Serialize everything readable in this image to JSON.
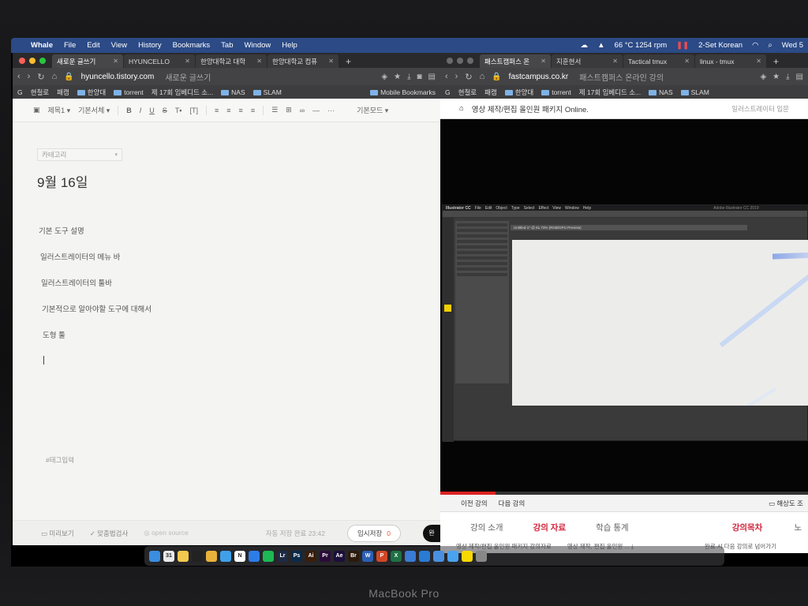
{
  "menubar": {
    "apple_glyph": "",
    "items": [
      "Whale",
      "File",
      "Edit",
      "View",
      "History",
      "Bookmarks",
      "Tab",
      "Window",
      "Help"
    ],
    "status": {
      "weather": "66 °C 1254 rpm",
      "input_method": "2-Set Korean",
      "clock": "Wed 5"
    }
  },
  "left_browser": {
    "tabs": [
      {
        "label": "새로운 글쓰기",
        "active": true
      },
      {
        "label": "HYUNCELLO",
        "active": false
      },
      {
        "label": "한양대학교 대학",
        "active": false
      },
      {
        "label": "한양대학교 컴퓨",
        "active": false
      }
    ],
    "url": "hyuncello.tistory.com",
    "url_subtitle": "새로운 글쓰기",
    "bookmarks": [
      "G",
      "현철로",
      "패캠",
      "한양대",
      "torrent",
      "제 17회 임베디드 소...",
      "NAS",
      "SLAM"
    ],
    "bookmarks_right": "Mobile Bookmarks"
  },
  "editor": {
    "toolbar": {
      "heading": "제목1",
      "font": "기본서체",
      "mode": "기본모드"
    },
    "category_placeholder": "카테고리",
    "title": "9월 16일",
    "lines": [
      "기본 도구 설명",
      "일러스트레이터의 메뉴 바",
      "일러스트레이터의 툴바",
      "기본적으로 알아야할 도구에 대해서",
      "도형 툴"
    ],
    "tag_placeholder": "#태그입력",
    "footer": {
      "preview": "미리보기",
      "spellcheck": "맞춤법검사",
      "open_source": "open source",
      "autosave": "자동 저장 완료 23:42",
      "draft_label": "임시저장",
      "draft_count": "0",
      "publish": "완"
    }
  },
  "right_browser": {
    "tabs": [
      {
        "label": "패스트캠퍼스 온",
        "active": true
      },
      {
        "label": "지훈현서",
        "active": false
      },
      {
        "label": "Tactical tmux",
        "active": false
      },
      {
        "label": "linux - tmux",
        "active": false
      }
    ],
    "url": "fastcampus.co.kr",
    "url_subtitle": "패스트캠퍼스 온라인 강의",
    "bookmarks": [
      "G",
      "현철로",
      "패캠",
      "한양대",
      "torrent",
      "제 17회 임베디드 소...",
      "NAS",
      "SLAM"
    ],
    "site_title": "영상 제작/편집 올인원 패키지 Online.",
    "site_right": "일러스트레이터 입문",
    "illustrator": {
      "app": "Illustrator CC",
      "menus": [
        "File",
        "Edit",
        "Object",
        "Type",
        "Select",
        "Effect",
        "View",
        "Window",
        "Help"
      ],
      "window_title": "Adobe Illustrator CC 2019",
      "doc_tab": "Untitled-1* @ 61.73% (RGB/GPU Preview)"
    },
    "video_progress": 0.15,
    "lesson_nav": {
      "prev": "이전 강의",
      "next": "다음 강의",
      "quality": "해상도 조"
    },
    "lesson_tabs": {
      "intro": "강의 소개",
      "material": "강의 자료",
      "stats": "학습 통계",
      "toc": "강의목차",
      "notes": "노"
    },
    "lesson_sub": {
      "left": "영상 제작/편집 올인원 패키지 강의자료",
      "mid": "영상 제작, 편집 올인원 ...",
      "right": "완료 시 다음 강의로 넘어가기"
    }
  },
  "dock": {
    "icons": [
      {
        "name": "finder-icon",
        "color": "#3b8de0",
        "glyph": ""
      },
      {
        "name": "calendar-icon",
        "color": "#e9e9e9",
        "glyph": "31"
      },
      {
        "name": "notes-icon",
        "color": "#f2c94c",
        "glyph": ""
      },
      {
        "name": "terminal-icon",
        "color": "#222",
        "glyph": ""
      },
      {
        "name": "chrome-icon",
        "color": "#e8b23a",
        "glyph": ""
      },
      {
        "name": "whale-icon",
        "color": "#3fa0e8",
        "glyph": ""
      },
      {
        "name": "notion-icon",
        "color": "#fff",
        "glyph": "N"
      },
      {
        "name": "app-store-icon",
        "color": "#2d7de8",
        "glyph": ""
      },
      {
        "name": "spotify-icon",
        "color": "#1db954",
        "glyph": ""
      },
      {
        "name": "lightroom-icon",
        "color": "#1f2a44",
        "glyph": "Lr"
      },
      {
        "name": "photoshop-icon",
        "color": "#0b2a4a",
        "glyph": "Ps"
      },
      {
        "name": "illustrator-icon",
        "color": "#3a1e0a",
        "glyph": "Ai"
      },
      {
        "name": "premiere-icon",
        "color": "#2a0c3a",
        "glyph": "Pr"
      },
      {
        "name": "after-effects-icon",
        "color": "#1c0f3a",
        "glyph": "Ae"
      },
      {
        "name": "bridge-icon",
        "color": "#2b1a0a",
        "glyph": "Br"
      },
      {
        "name": "word-icon",
        "color": "#2b5fb4",
        "glyph": "W"
      },
      {
        "name": "powerpoint-icon",
        "color": "#d24726",
        "glyph": "P"
      },
      {
        "name": "excel-icon",
        "color": "#1e7145",
        "glyph": "X"
      },
      {
        "name": "keynote-icon",
        "color": "#3a7bd5",
        "glyph": ""
      },
      {
        "name": "vscode-icon",
        "color": "#2a7bd5",
        "glyph": ""
      },
      {
        "name": "xcode-icon",
        "color": "#4a8fe0",
        "glyph": ""
      },
      {
        "name": "mail-icon",
        "color": "#4aa3f0",
        "glyph": ""
      },
      {
        "name": "kakaotalk-icon",
        "color": "#f7d800",
        "glyph": ""
      },
      {
        "name": "trash-icon",
        "color": "#888",
        "glyph": ""
      }
    ]
  },
  "brand": "MacBook Pro"
}
